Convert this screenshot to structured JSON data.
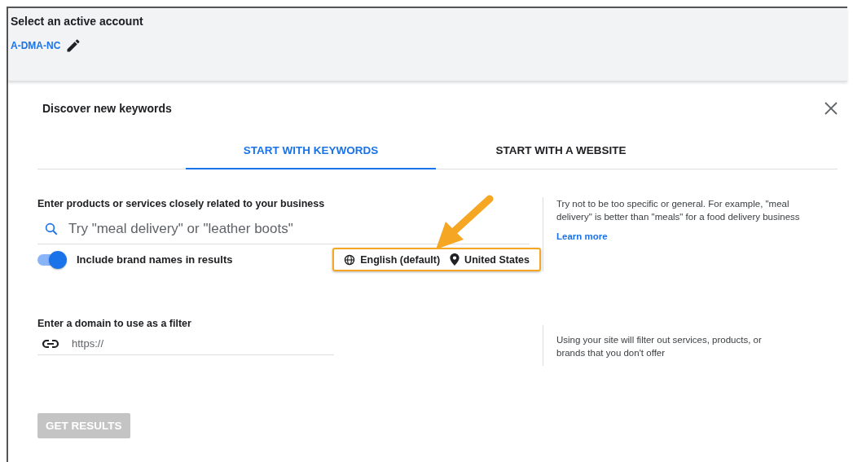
{
  "header": {
    "title": "Select an active account",
    "account": "A-DMA-NC"
  },
  "dialog": {
    "title": "Discover new keywords",
    "tabs": [
      {
        "label": "START WITH KEYWORDS",
        "selected": true
      },
      {
        "label": "START WITH A WEBSITE",
        "selected": false
      }
    ],
    "keywords": {
      "label": "Enter products or services closely related to your business",
      "placeholder": "Try \"meal delivery\" or \"leather boots\"",
      "toggle": {
        "label": "Include brand names in results",
        "on": true
      },
      "language": "English (default)",
      "location": "United States",
      "highlighted": true,
      "hint": "Try not to be too specific or general. For example, \"meal delivery\" is better than \"meals\" for a food delivery business",
      "link": "Learn more"
    },
    "domain": {
      "label": "Enter a domain to use as a filter",
      "placeholder": "https://",
      "hint": "Using your site will filter out services, products, or brands that you don't offer"
    },
    "button": {
      "label": "GET RESULTS",
      "disabled": true
    }
  }
}
